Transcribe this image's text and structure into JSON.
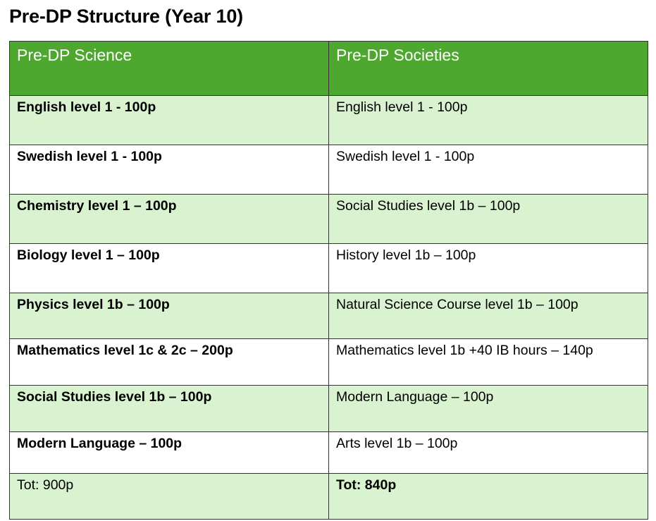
{
  "title": "Pre-DP Structure (Year 10)",
  "colors": {
    "header_bg": "#4ea72e",
    "header_text": "#ffffff",
    "row_shade": "#d9f2d0",
    "row_plain": "#ffffff"
  },
  "table": {
    "headers": [
      "Pre-DP Science",
      "Pre-DP Societies"
    ],
    "rows": [
      [
        "English level 1 - 100p",
        "English level 1 - 100p"
      ],
      [
        "Swedish level 1 - 100p",
        "Swedish level 1 - 100p"
      ],
      [
        "Chemistry level 1 – 100p",
        "Social Studies level 1b – 100p"
      ],
      [
        "Biology level 1 – 100p",
        "History level 1b – 100p"
      ],
      [
        "Physics level 1b – 100p",
        "Natural Science Course level 1b – 100p"
      ],
      [
        "Mathematics level 1c & 2c – 200p",
        "Mathematics level 1b +40 IB hours – 140p"
      ],
      [
        "Social Studies level 1b – 100p",
        "Modern Language – 100p"
      ],
      [
        "Modern Language – 100p",
        "Arts level 1b – 100p"
      ],
      [
        "Tot: 900p",
        "Tot: 840p"
      ]
    ]
  }
}
